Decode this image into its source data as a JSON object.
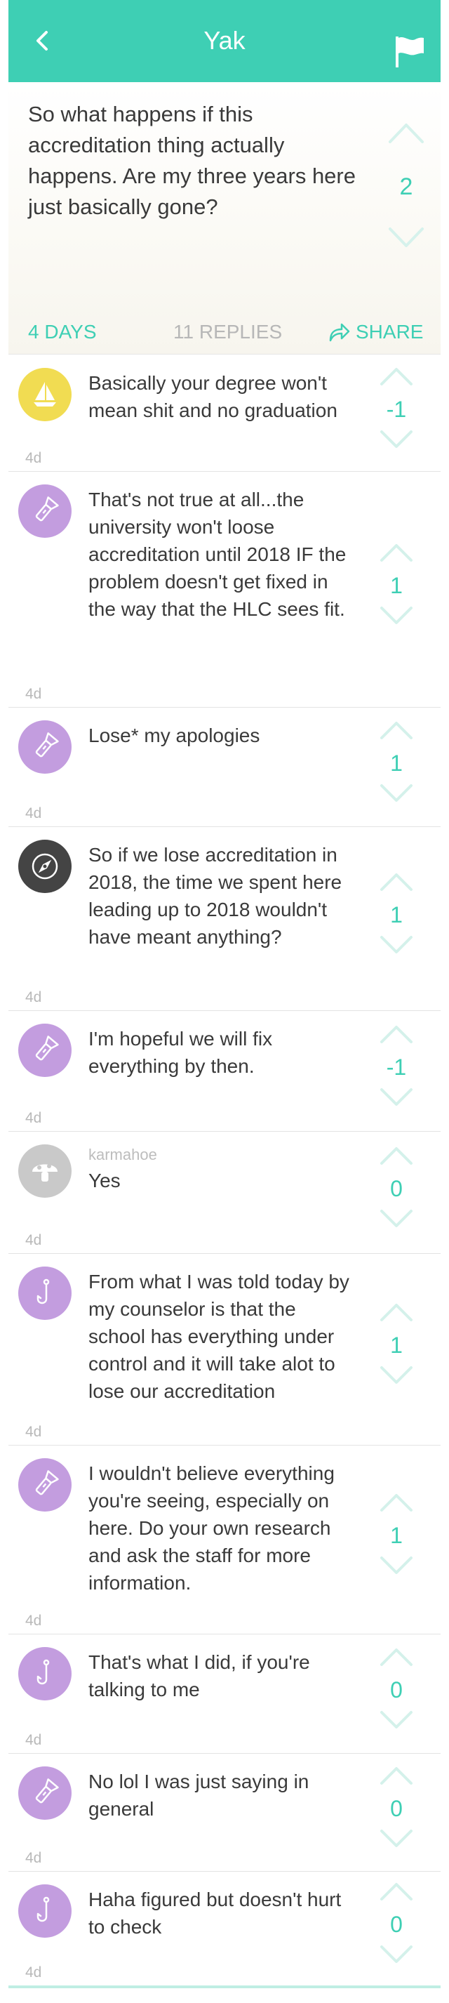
{
  "colors": {
    "accent": "#3ecfb4",
    "light_accent": "#bfeee3",
    "avatar_yellow": "#f1dc52",
    "avatar_purple": "#c39ddf",
    "avatar_dark": "#444444",
    "avatar_gray": "#c9c9c9"
  },
  "header": {
    "title": "Yak",
    "back_icon": "chevron-left-icon",
    "flag_icon": "flag-icon"
  },
  "post": {
    "text": "So what happens if this accreditation thing actually happens. Are my three years here just basically gone?",
    "score": "2",
    "age": "4 DAYS",
    "replies": "11 REPLIES",
    "share": "SHARE"
  },
  "replies": [
    {
      "icon": "sailboat-icon",
      "color": "avatar_yellow",
      "user": "",
      "text": "Basically your degree won't mean shit and no graduation",
      "score": "-1",
      "time": "4d"
    },
    {
      "icon": "flashlight-icon",
      "color": "avatar_purple",
      "user": "",
      "text": "That's not true at all...the university won't loose accreditation until 2018 IF the problem doesn't get fixed in the way that the HLC sees fit.",
      "score": "1",
      "time": "4d"
    },
    {
      "icon": "flashlight-icon",
      "color": "avatar_purple",
      "user": "",
      "text": "Lose* my apologies",
      "score": "1",
      "time": "4d"
    },
    {
      "icon": "compass-icon",
      "color": "avatar_dark",
      "user": "",
      "text": "So if we lose accreditation in 2018, the time we spent here leading up to 2018 wouldn't have meant anything?",
      "score": "1",
      "time": "4d"
    },
    {
      "icon": "flashlight-icon",
      "color": "avatar_purple",
      "user": "",
      "text": "I'm hopeful we will fix everything by then.",
      "score": "-1",
      "time": "4d"
    },
    {
      "icon": "mushroom-icon",
      "color": "avatar_gray",
      "user": "karmahoe",
      "text": "Yes",
      "score": "0",
      "time": "4d"
    },
    {
      "icon": "fishhook-icon",
      "color": "avatar_purple",
      "user": "",
      "text": "From what I was told today by my counselor is that the school has everything under control and it will take alot to lose our accreditation",
      "score": "1",
      "time": "4d"
    },
    {
      "icon": "flashlight-icon",
      "color": "avatar_purple",
      "user": "",
      "text": "I wouldn't believe everything you're seeing, especially on here. Do your own research and ask the staff for more information.",
      "score": "1",
      "time": "4d"
    },
    {
      "icon": "fishhook-icon",
      "color": "avatar_purple",
      "user": "",
      "text": "That's what I did, if you're talking to me",
      "score": "0",
      "time": "4d"
    },
    {
      "icon": "flashlight-icon",
      "color": "avatar_purple",
      "user": "",
      "text": "No lol I was just saying in general",
      "score": "0",
      "time": "4d"
    },
    {
      "icon": "fishhook-icon",
      "color": "avatar_purple",
      "user": "",
      "text": "Haha figured but doesn't hurt to check",
      "score": "0",
      "time": "4d"
    }
  ]
}
